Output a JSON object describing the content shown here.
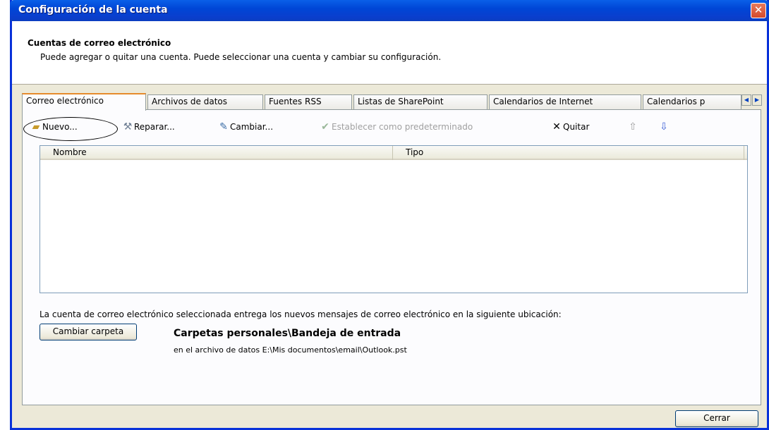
{
  "window": {
    "title": "Configuración de la cuenta",
    "close_glyph": "✕"
  },
  "header": {
    "title": "Cuentas de correo electrónico",
    "description": "Puede agregar o quitar una cuenta. Puede seleccionar una cuenta y cambiar su configuración."
  },
  "tabs": [
    {
      "label": "Correo electrónico",
      "active": true
    },
    {
      "label": "Archivos de datos",
      "active": false
    },
    {
      "label": "Fuentes RSS",
      "active": false
    },
    {
      "label": "Listas de SharePoint",
      "active": false
    },
    {
      "label": "Calendarios de Internet",
      "active": false
    },
    {
      "label": "Calendarios p",
      "active": false
    }
  ],
  "toolbar": {
    "new_label": "Nuevo...",
    "repair_label": "Reparar...",
    "change_label": "Cambiar...",
    "set_default_label": "Establecer como predeterminado",
    "remove_label": "Quitar",
    "move_up_glyph": "⇧",
    "move_down_glyph": "⇩"
  },
  "table": {
    "columns": [
      "Nombre",
      "Tipo"
    ],
    "rows": []
  },
  "delivery": {
    "description": "La cuenta de correo electrónico seleccionada entrega los nuevos mensajes de correo electrónico en la siguiente ubicación:",
    "change_folder_label": "Cambiar carpeta",
    "folder_path": "Carpetas personales\\Bandeja de entrada",
    "data_file": "en el archivo de datos E:\\Mis documentos\\email\\Outlook.pst"
  },
  "footer": {
    "close_label": "Cerrar"
  },
  "icons": {
    "new": "new-account-icon",
    "repair": "repair-icon",
    "change": "change-icon",
    "set_default": "set-default-icon",
    "remove": "remove-icon",
    "move_up": "arrow-up-icon",
    "move_down": "arrow-down-icon"
  },
  "colors": {
    "titlebar": "#0046d6",
    "active_tab_accent": "#e68b2c",
    "window_bg": "#ece9d8"
  }
}
